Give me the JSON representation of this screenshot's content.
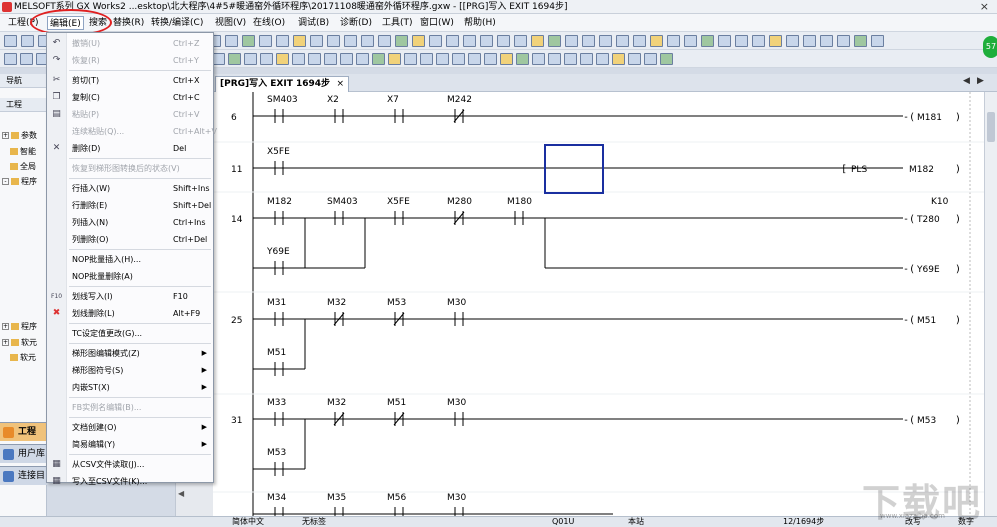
{
  "window": {
    "title": "MELSOFT系列 GX Works2 ...esktop\\北大程序\\4#5#暖通窑外循环程序\\20171108暖通窑外循环程序.gxw - [[PRG]写入 EXIT 1694步]"
  },
  "menubar": {
    "items": [
      {
        "label": "工程(P)"
      },
      {
        "label": "编辑(E)"
      },
      {
        "label": "搜索"
      },
      {
        "label": "替换(R)"
      },
      {
        "label": "转换/编译(C)"
      },
      {
        "label": "视图(V)"
      },
      {
        "label": "在线(O)"
      },
      {
        "label": "调试(B)"
      },
      {
        "label": "诊断(D)"
      },
      {
        "label": "工具(T)"
      },
      {
        "label": "窗口(W)"
      },
      {
        "label": "帮助(H)"
      }
    ]
  },
  "badge": {
    "value": "57"
  },
  "left_pane": {
    "nav_title": "导航",
    "panel_title": "工程",
    "tree": [
      {
        "expander": "+",
        "label": "参数"
      },
      {
        "expander": "",
        "label": "智能"
      },
      {
        "expander": "",
        "label": "全局"
      },
      {
        "expander": "-",
        "label": "程序"
      },
      {
        "expander": "+",
        "label": "程序"
      },
      {
        "expander": "+",
        "label": "软元"
      },
      {
        "expander": "",
        "label": "软元"
      }
    ],
    "nav_buttons": [
      {
        "label": "工程"
      },
      {
        "label": "用户库"
      },
      {
        "label": "连接目"
      }
    ]
  },
  "tab": {
    "label": "[PRG]写入 EXIT 1694步",
    "close": "×"
  },
  "edit_menu": {
    "items": [
      {
        "label": "撤销(U)",
        "shortcut": "Ctrl+Z",
        "disabled": true,
        "icon": "undo-icon",
        "glyph": "↶"
      },
      {
        "label": "恢复(R)",
        "shortcut": "Ctrl+Y",
        "disabled": true,
        "icon": "redo-icon",
        "glyph": "↷"
      },
      {
        "sep": true
      },
      {
        "label": "剪切(T)",
        "shortcut": "Ctrl+X",
        "disabled": false,
        "icon": "cut-icon",
        "glyph": "✂"
      },
      {
        "label": "复制(C)",
        "shortcut": "Ctrl+C",
        "disabled": false,
        "icon": "copy-icon",
        "glyph": "❐"
      },
      {
        "label": "粘贴(P)",
        "shortcut": "Ctrl+V",
        "disabled": true,
        "icon": "paste-icon",
        "glyph": "▤"
      },
      {
        "label": "连续粘贴(Q)...",
        "shortcut": "Ctrl+Alt+V",
        "disabled": true,
        "icon": "",
        "glyph": ""
      },
      {
        "label": "删除(D)",
        "shortcut": "Del",
        "disabled": false,
        "icon": "delete-icon",
        "glyph": "✕"
      },
      {
        "sep": true
      },
      {
        "label": "恢复到梯形图转换后的状态(V)",
        "shortcut": "",
        "disabled": true,
        "icon": "",
        "glyph": ""
      },
      {
        "sep": true
      },
      {
        "label": "行插入(W)",
        "shortcut": "Shift+Ins",
        "disabled": false,
        "icon": "",
        "glyph": ""
      },
      {
        "label": "行删除(E)",
        "shortcut": "Shift+Del",
        "disabled": false,
        "icon": "",
        "glyph": ""
      },
      {
        "label": "列插入(N)",
        "shortcut": "Ctrl+Ins",
        "disabled": false,
        "icon": "",
        "glyph": ""
      },
      {
        "label": "列删除(O)",
        "shortcut": "Ctrl+Del",
        "disabled": false,
        "icon": "",
        "glyph": ""
      },
      {
        "sep": true
      },
      {
        "label": "NOP批量插入(H)...",
        "shortcut": "",
        "disabled": false,
        "icon": "",
        "glyph": ""
      },
      {
        "label": "NOP批量删除(A)",
        "shortcut": "",
        "disabled": false,
        "icon": "",
        "glyph": ""
      },
      {
        "sep": true
      },
      {
        "label": "划线写入(I)",
        "shortcut": "F10",
        "disabled": false,
        "icon": "draw-line-icon",
        "glyph": "F10"
      },
      {
        "label": "划线删除(L)",
        "shortcut": "Alt+F9",
        "disabled": false,
        "icon": "erase-line-icon",
        "glyph": "✖"
      },
      {
        "sep": true
      },
      {
        "label": "TC设定值更改(G)...",
        "shortcut": "",
        "disabled": false,
        "icon": "",
        "glyph": ""
      },
      {
        "sep": true
      },
      {
        "label": "梯形图编辑模式(Z)",
        "shortcut": "",
        "disabled": false,
        "submenu": true,
        "icon": "",
        "glyph": ""
      },
      {
        "label": "梯形图符号(S)",
        "shortcut": "",
        "disabled": false,
        "submenu": true,
        "icon": "",
        "glyph": ""
      },
      {
        "label": "内嵌ST(X)",
        "shortcut": "",
        "disabled": false,
        "submenu": true,
        "icon": "",
        "glyph": ""
      },
      {
        "sep": true
      },
      {
        "label": "FB实例名编辑(B)...",
        "shortcut": "",
        "disabled": true,
        "icon": "",
        "glyph": ""
      },
      {
        "sep": true
      },
      {
        "label": "文档创建(O)",
        "shortcut": "",
        "disabled": false,
        "submenu": true,
        "icon": "",
        "glyph": ""
      },
      {
        "label": "简易编辑(Y)",
        "shortcut": "",
        "disabled": false,
        "submenu": true,
        "icon": "",
        "glyph": ""
      },
      {
        "sep": true
      },
      {
        "label": "从CSV文件读取(J)...",
        "shortcut": "",
        "disabled": false,
        "icon": "csv-read-icon",
        "glyph": "▦"
      },
      {
        "label": "写入至CSV文件(K)...",
        "shortcut": "",
        "disabled": false,
        "icon": "csv-write-icon",
        "glyph": "▦"
      }
    ],
    "submenu_arrow": "▶"
  },
  "ladder": {
    "rungs": [
      {
        "step": "6",
        "contacts": [
          {
            "name": "SM403",
            "type": "NO"
          },
          {
            "name": "X2",
            "type": "NO"
          },
          {
            "name": "X7",
            "type": "NO"
          },
          {
            "name": "M242",
            "type": "NC"
          }
        ],
        "coil": "M181"
      },
      {
        "step": "11",
        "contacts": [
          {
            "name": "X5FE",
            "type": "NO"
          }
        ],
        "instruction": "PLS",
        "operand": "M182"
      },
      {
        "step": "14",
        "contacts": [
          {
            "name": "M182",
            "type": "NO"
          },
          {
            "name": "SM403",
            "type": "NO"
          },
          {
            "name": "X5FE",
            "type": "NO"
          },
          {
            "name": "M280",
            "type": "NC"
          },
          {
            "name": "M180",
            "type": "NO"
          }
        ],
        "branch_contact": "Y69E",
        "coil": "T280",
        "coil_setting": "K10",
        "second_coil": "Y69E"
      },
      {
        "step": "25",
        "contacts": [
          {
            "name": "M31",
            "type": "NO"
          },
          {
            "name": "M32",
            "type": "NC"
          },
          {
            "name": "M53",
            "type": "NC"
          },
          {
            "name": "M30",
            "type": "NO"
          }
        ],
        "branch_contact": "M51",
        "coil": "M51"
      },
      {
        "step": "31",
        "contacts": [
          {
            "name": "M33",
            "type": "NO"
          },
          {
            "name": "M32",
            "type": "NC"
          },
          {
            "name": "M51",
            "type": "NC"
          },
          {
            "name": "M30",
            "type": "NO"
          }
        ],
        "branch_contact": "M53",
        "coil": "M53"
      },
      {
        "step": "",
        "contacts": [
          {
            "name": "M34",
            "type": "NO"
          },
          {
            "name": "M35",
            "type": "NO"
          },
          {
            "name": "M56",
            "type": "NO"
          },
          {
            "name": "M30",
            "type": "NO"
          }
        ]
      }
    ]
  },
  "status_bar": {
    "language": "简体中文",
    "label": "无标签",
    "cpu": "Q01U",
    "station": "本站",
    "steps": "12/1694步",
    "mode": "改写",
    "numlock": "数字"
  },
  "watermark": {
    "text": "下载吧",
    "url": "www.xiazaiba.com"
  },
  "colors": {
    "cursor": "#1a2fa0",
    "highlight_circle": "#e02020",
    "badge": "#1fae3b"
  }
}
